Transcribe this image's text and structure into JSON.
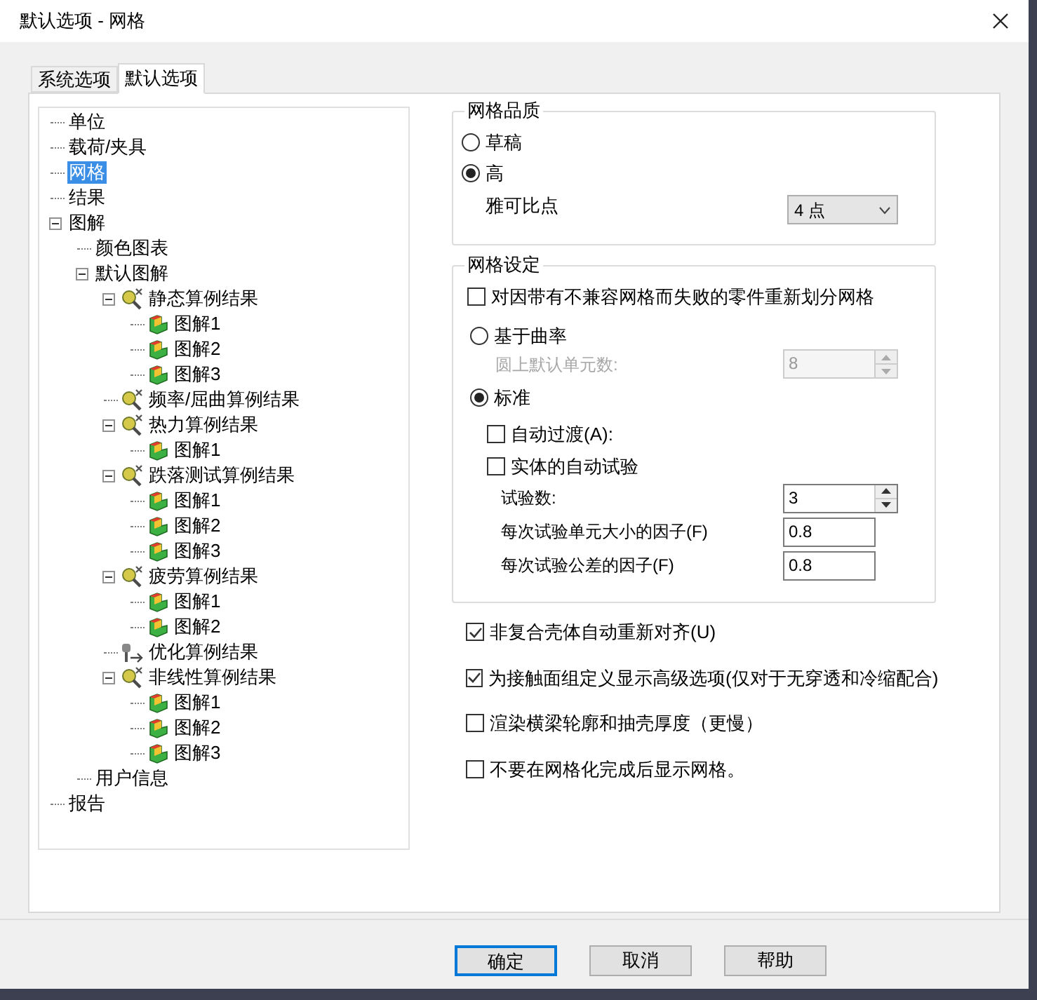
{
  "window": {
    "title": "默认选项 - 网格"
  },
  "tabs": [
    {
      "label": "系统选项",
      "selected": false
    },
    {
      "label": "默认选项",
      "selected": true
    }
  ],
  "tree": [
    {
      "label": "单位",
      "selected": false
    },
    {
      "label": "载荷/夹具",
      "selected": false
    },
    {
      "label": "网格",
      "selected": true
    },
    {
      "label": "结果",
      "selected": false
    },
    {
      "label": "图解",
      "selected": false,
      "expanded": true,
      "children": [
        {
          "label": "颜色图表",
          "selected": false
        },
        {
          "label": "默认图解",
          "selected": false,
          "expanded": true,
          "children": [
            {
              "label": "静态算例结果",
              "kind": "study",
              "selected": false,
              "expanded": true,
              "children": [
                {
                  "label": "图解1",
                  "kind": "plot",
                  "selected": false
                },
                {
                  "label": "图解2",
                  "kind": "plot",
                  "selected": false
                },
                {
                  "label": "图解3",
                  "kind": "plot",
                  "selected": false
                }
              ]
            },
            {
              "label": "频率/屈曲算例结果",
              "kind": "study",
              "selected": false
            },
            {
              "label": "热力算例结果",
              "kind": "study",
              "selected": false,
              "expanded": true,
              "children": [
                {
                  "label": "图解1",
                  "kind": "plot",
                  "selected": false
                }
              ]
            },
            {
              "label": "跌落测试算例结果",
              "kind": "study",
              "selected": false,
              "expanded": true,
              "children": [
                {
                  "label": "图解1",
                  "kind": "plot",
                  "selected": false
                },
                {
                  "label": "图解2",
                  "kind": "plot",
                  "selected": false
                },
                {
                  "label": "图解3",
                  "kind": "plot",
                  "selected": false
                }
              ]
            },
            {
              "label": "疲劳算例结果",
              "kind": "study",
              "selected": false,
              "expanded": true,
              "children": [
                {
                  "label": "图解1",
                  "kind": "plot",
                  "selected": false
                },
                {
                  "label": "图解2",
                  "kind": "plot",
                  "selected": false
                }
              ]
            },
            {
              "label": "优化算例结果",
              "kind": "optimize",
              "selected": false
            },
            {
              "label": "非线性算例结果",
              "kind": "study",
              "selected": false,
              "expanded": true,
              "children": [
                {
                  "label": "图解1",
                  "kind": "plot",
                  "selected": false
                },
                {
                  "label": "图解2",
                  "kind": "plot",
                  "selected": false
                },
                {
                  "label": "图解3",
                  "kind": "plot",
                  "selected": false
                }
              ]
            }
          ]
        },
        {
          "label": "用户信息",
          "selected": false
        }
      ]
    },
    {
      "label": "报告",
      "selected": false
    }
  ],
  "mesh_quality": {
    "title": "网格品质",
    "options": [
      {
        "label": "草稿",
        "selected": false
      },
      {
        "label": "高",
        "selected": true
      }
    ],
    "jacobian": {
      "label": "雅可比点",
      "value": "4 点"
    }
  },
  "mesh_settings": {
    "title": "网格设定",
    "remesh": {
      "label": "对因带有不兼容网格而失败的零件重新划分网格",
      "checked": false
    },
    "curvature": {
      "label": "基于曲率",
      "selected": false,
      "sub_label": "圆上默认单元数:",
      "sub_value": "8",
      "disabled": true
    },
    "standard": {
      "label": "标准",
      "selected": true
    },
    "auto_transition": {
      "label": "自动过渡(A):",
      "checked": false
    },
    "auto_trials": {
      "label": "实体的自动试验",
      "checked": false
    },
    "fields": [
      {
        "label": "试验数:",
        "value": "3",
        "kind": "spin"
      },
      {
        "label": "每次试验单元大小的因子(F)",
        "value": "0.8",
        "kind": "text"
      },
      {
        "label": "每次试验公差的因子(F)",
        "value": "0.8",
        "kind": "text"
      }
    ]
  },
  "options": [
    {
      "label": "非复合壳体自动重新对齐(U)",
      "checked": true
    },
    {
      "label": "为接触面组定义显示高级选项(仅对于无穿透和冷缩配合)",
      "checked": true
    },
    {
      "label": "渲染横梁轮廓和抽壳厚度（更慢）",
      "checked": false
    },
    {
      "label": "不要在网格化完成后显示网格。",
      "checked": false
    }
  ],
  "buttons": [
    {
      "label": "确定",
      "kind": "default"
    },
    {
      "label": "取消",
      "kind": "normal"
    },
    {
      "label": "帮助",
      "kind": "normal"
    }
  ]
}
